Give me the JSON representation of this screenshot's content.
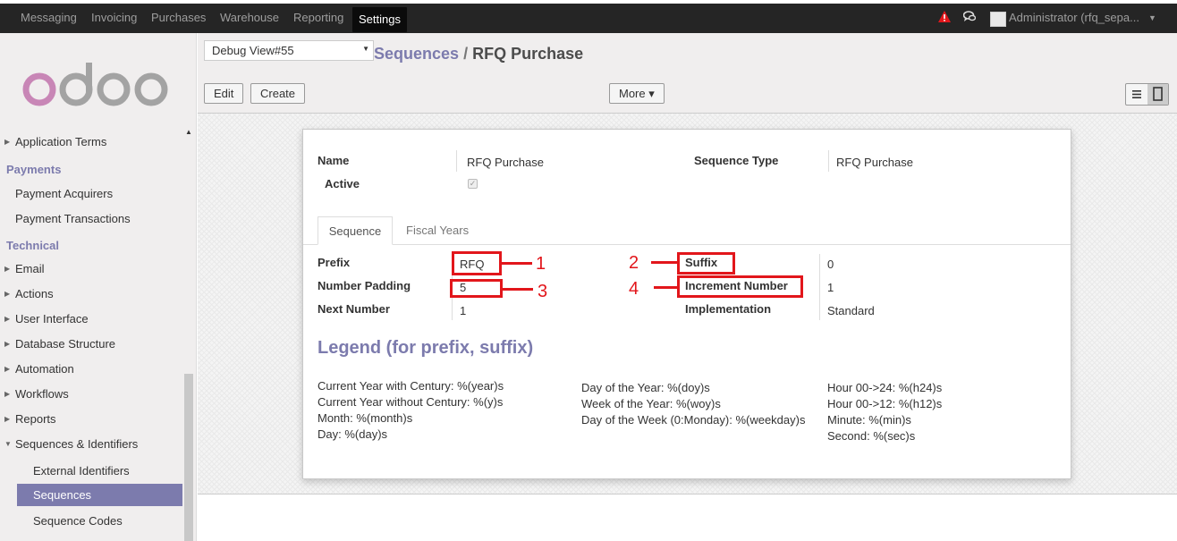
{
  "topbar": {
    "menu": [
      "Messaging",
      "Invoicing",
      "Purchases",
      "Warehouse",
      "Reporting",
      "Settings"
    ],
    "active": "Settings",
    "user": "Administrator (rfq_sepa..."
  },
  "sidebar": {
    "logo_text": "odoo",
    "application_terms": "Application Terms",
    "payments_header": "Payments",
    "payment_acquirers": "Payment Acquirers",
    "payment_transactions": "Payment Transactions",
    "technical_header": "Technical",
    "items": [
      "Email",
      "Actions",
      "User Interface",
      "Database Structure",
      "Automation",
      "Workflows",
      "Reports",
      "Sequences & Identifiers"
    ],
    "sub_items": [
      "External Identifiers",
      "Sequences",
      "Sequence Codes"
    ],
    "active_item": "Sequences"
  },
  "control_panel": {
    "debug_select": "Debug View#55",
    "breadcrumb_parent": "Sequences",
    "breadcrumb_sep": "/",
    "breadcrumb_current": "RFQ Purchase",
    "edit_label": "Edit",
    "create_label": "Create",
    "more_label": "More ▾"
  },
  "form": {
    "name_label": "Name",
    "name_value": "RFQ Purchase",
    "active_label": "Active",
    "sequence_type_label": "Sequence Type",
    "sequence_type_value": "RFQ Purchase",
    "tabs": [
      "Sequence",
      "Fiscal Years"
    ],
    "prefix_label": "Prefix",
    "prefix_value": "RFQ",
    "number_padding_label": "Number Padding",
    "number_padding_value": "5",
    "next_number_label": "Next Number",
    "next_number_value": "1",
    "suffix_label": "Suffix",
    "suffix_value": "0",
    "increment_label": "Increment Number",
    "increment_value": "1",
    "implementation_label": "Implementation",
    "implementation_value": "Standard"
  },
  "annotations": [
    "1",
    "2",
    "3",
    "4"
  ],
  "legend": {
    "title": "Legend (for prefix, suffix)",
    "col1": [
      "Current Year with Century: %(year)s",
      "Current Year without Century: %(y)s",
      "Month: %(month)s",
      "Day: %(day)s"
    ],
    "col2": [
      "Day of the Year: %(doy)s",
      "Week of the Year: %(woy)s",
      "Day of the Week (0:Monday): %(weekday)s"
    ],
    "col3": [
      "Hour 00->24: %(h24)s",
      "Hour 00->12: %(h12)s",
      "Minute: %(min)s",
      "Second: %(sec)s"
    ]
  },
  "colors": {
    "accent": "#7c7bad",
    "annotation_red": "#e2161b",
    "topbar": "#252525"
  }
}
